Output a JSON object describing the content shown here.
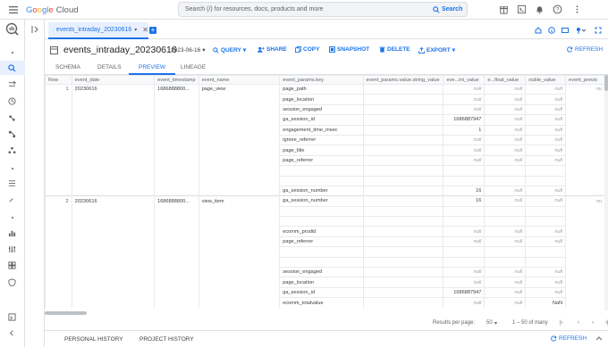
{
  "app": {
    "brand": [
      "G",
      "o",
      "o",
      "g",
      "l",
      "e"
    ],
    "brand_suffix": "Cloud"
  },
  "search": {
    "placeholder": "Search (/) for resources, docs, products and more",
    "button_label": "Search"
  },
  "tab": {
    "label": "events_intraday_20230616"
  },
  "title": "events_intraday_20230616",
  "toolbar": {
    "date": "2023-06-16",
    "query": "QUERY",
    "share": "SHARE",
    "copy": "COPY",
    "snapshot": "SNAPSHOT",
    "delete": "DELETE",
    "export": "EXPORT",
    "refresh": "REFRESH"
  },
  "subtabs": [
    "SCHEMA",
    "DETAILS",
    "PREVIEW",
    "LINEAGE"
  ],
  "table": {
    "columns": [
      "Row",
      "event_date",
      "event_timestamp",
      "event_name",
      "event_params.key",
      "event_params.value.string_value",
      "eve...int_value",
      "e...float_value",
      "ouble_value",
      "event_previo"
    ],
    "rows": [
      [
        "1",
        "20230616",
        "1686888800...",
        "page_view",
        "page_path",
        "",
        "null",
        "null",
        "null",
        "nu"
      ],
      [
        "",
        "",
        "",
        "",
        "page_location",
        "",
        "null",
        "null",
        "null",
        ""
      ],
      [
        "",
        "",
        "",
        "",
        "session_engaged",
        "",
        "null",
        "null",
        "null",
        ""
      ],
      [
        "",
        "",
        "",
        "",
        "ga_session_id",
        "",
        "1686887947",
        "null",
        "null",
        ""
      ],
      [
        "",
        "",
        "",
        "",
        "engagement_time_msec",
        "",
        "1",
        "null",
        "null",
        ""
      ],
      [
        "",
        "",
        "",
        "",
        "ignore_referrer",
        "",
        "null",
        "null",
        "null",
        ""
      ],
      [
        "",
        "",
        "",
        "",
        "page_title",
        "",
        "null",
        "null",
        "null",
        ""
      ],
      [
        "",
        "",
        "",
        "",
        "page_referrer",
        "",
        "null",
        "null",
        "null",
        ""
      ],
      [
        "",
        "",
        "",
        "",
        "",
        "",
        "",
        "",
        "",
        ""
      ],
      [
        "",
        "",
        "",
        "",
        "",
        "",
        "",
        "",
        "",
        ""
      ],
      [
        "",
        "",
        "",
        "",
        "ga_session_number",
        "",
        "16",
        "null",
        "null",
        ""
      ],
      [
        "2",
        "20230616",
        "1686888800...",
        "view_item",
        "ga_session_number",
        "",
        "16",
        "null",
        "null",
        "nu"
      ],
      [
        "",
        "",
        "",
        "",
        "",
        "",
        "",
        "",
        "",
        ""
      ],
      [
        "",
        "",
        "",
        "",
        "",
        "",
        "",
        "",
        "",
        ""
      ],
      [
        "",
        "",
        "",
        "",
        "ecomm_prodid",
        "",
        "null",
        "null",
        "null",
        ""
      ],
      [
        "",
        "",
        "",
        "",
        "page_referrer",
        "",
        "null",
        "null",
        "null",
        ""
      ],
      [
        "",
        "",
        "",
        "",
        "",
        "",
        "",
        "",
        "",
        ""
      ],
      [
        "",
        "",
        "",
        "",
        "",
        "",
        "",
        "",
        "",
        ""
      ],
      [
        "",
        "",
        "",
        "",
        "session_engaged",
        "",
        "null",
        "null",
        "null",
        ""
      ],
      [
        "",
        "",
        "",
        "",
        "page_location",
        "",
        "null",
        "null",
        "null",
        ""
      ],
      [
        "",
        "",
        "",
        "",
        "ga_session_id",
        "",
        "1686887947",
        "null",
        "null",
        ""
      ],
      [
        "",
        "",
        "",
        "",
        "ecomm_totalvalue",
        "",
        "null",
        "null",
        "NaN",
        ""
      ]
    ]
  },
  "pagination": {
    "rows_label": "Results per page:",
    "rows_value": "50",
    "range": "1 – 50 of many"
  },
  "bottom": {
    "personal": "PERSONAL HISTORY",
    "project": "PROJECT HISTORY",
    "refresh": "REFRESH"
  },
  "colors": {
    "accent": "#1a73e8",
    "header_bg": "#f8f9fa",
    "border": "#e0e0e0"
  }
}
